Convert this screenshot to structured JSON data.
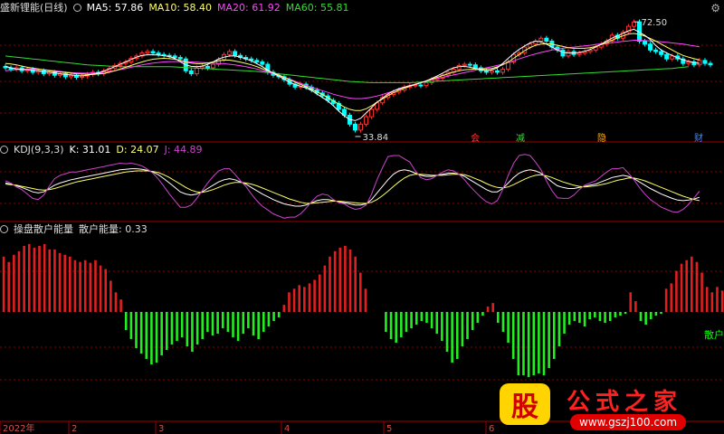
{
  "header": {
    "main": {
      "title": "盛新锂能(日线)",
      "ma": [
        {
          "label": "MA5: 57.86",
          "color": "#ffffff"
        },
        {
          "label": "MA10: 58.40",
          "color": "#ffff66"
        },
        {
          "label": "MA20: 61.92",
          "color": "#ff44ff"
        },
        {
          "label": "MA60: 55.81",
          "color": "#33dd33"
        }
      ]
    },
    "kdj": {
      "title": "KDJ(9,3,3)",
      "k": "K: 31.01",
      "d": "D: 24.07",
      "j": "J: 44.89"
    },
    "energy": {
      "title": "操盘散户能量",
      "value": "散户能量: 0.33"
    }
  },
  "side_label": "散户",
  "price_annotations": {
    "high": "72.50",
    "low": "33.84"
  },
  "signals": [
    {
      "label": "会",
      "color": "#ff3030"
    },
    {
      "label": "减",
      "color": "#33dd33"
    },
    {
      "label": "隐",
      "color": "#ffaa00"
    },
    {
      "label": "财",
      "color": "#4488ff"
    }
  ],
  "x_axis": [
    "2022年",
    "2",
    "3",
    "4",
    "5",
    "6"
  ],
  "brand": {
    "logo": "股",
    "title": "公式之家",
    "url": "www.gszj100.com"
  },
  "colors": {
    "up": "#ff3030",
    "down": "#00ffff",
    "grid": "#8b0000",
    "pos_bar": "#e02020",
    "neg_bar": "#22ee22"
  },
  "chart_data": [
    {
      "type": "candlestick",
      "title": "盛新锂能(日线)",
      "ylim": [
        32,
        75
      ],
      "annotations": [
        {
          "label": "72.50",
          "value": 72.5
        },
        {
          "label": "33.84",
          "value": 33.84
        }
      ],
      "close": [
        57,
        56.5,
        57,
        56,
        56.5,
        55.5,
        56,
        55,
        55.5,
        54.5,
        55,
        54,
        54.5,
        53.8,
        54.2,
        54.8,
        55.5,
        55,
        56,
        56.8,
        57.8,
        58.5,
        59,
        60.2,
        61,
        62,
        62.5,
        62,
        61.5,
        61.2,
        61,
        60.5,
        60,
        56,
        55,
        57,
        57.5,
        57,
        58.2,
        59.8,
        61.5,
        62.5,
        61.2,
        60.5,
        60,
        59.5,
        59,
        58.2,
        55.5,
        54.5,
        54,
        53,
        51.5,
        50.5,
        51.5,
        50.5,
        49.5,
        48.5,
        47.5,
        46,
        45,
        43,
        41,
        38,
        36,
        38,
        40.5,
        43,
        45.2,
        47,
        48,
        48.8,
        49.5,
        50.5,
        51,
        51.2,
        51,
        52,
        53,
        53.5,
        54.5,
        55.5,
        56.5,
        57.8,
        58.2,
        58,
        57,
        56,
        55.5,
        56,
        55.5,
        56.5,
        59,
        61.5,
        62,
        64,
        65,
        66,
        67,
        66,
        64,
        63,
        61,
        62.5,
        61.5,
        62,
        62.5,
        63,
        64,
        65,
        66,
        68,
        67,
        69,
        71,
        72.5,
        66,
        65,
        63,
        62.5,
        61.5,
        60,
        61,
        60,
        58.5,
        59,
        58,
        59.5,
        58.5,
        58
      ],
      "ma5": [
        57.5,
        57,
        56.6,
        56.5,
        56.4,
        56.2,
        56,
        55.7,
        55.5,
        55.3,
        55,
        54.8,
        54.6,
        54.4,
        54.3,
        54.5,
        54.9,
        55.3,
        55.9,
        56.6,
        57.4,
        58.2,
        59,
        59.8,
        60.6,
        61.2,
        61.4,
        61.4,
        61.3,
        61.1,
        60.8,
        60.2,
        59,
        58,
        57.5,
        57.4,
        57.6,
        58.2,
        59,
        60,
        60.6,
        61,
        61,
        60.6,
        60,
        59.4,
        58.4,
        57.4,
        56.2,
        55.2,
        54.2,
        53.2,
        52.2,
        51.4,
        50.8,
        50.2,
        49.4,
        48.2,
        47,
        45.8,
        44.2,
        42.4,
        40.8,
        39.6,
        39.2,
        40,
        41.8,
        43.6,
        45.4,
        46.8,
        48.2,
        49.2,
        50,
        50.5,
        51,
        51.4,
        51.9,
        52.6,
        53.4,
        54.3,
        55.2,
        56.2,
        57,
        57.4,
        57.5,
        57.2,
        56.8,
        56.4,
        56.1,
        56.3,
        57,
        58.5,
        60.2,
        61.8,
        63.2,
        64.4,
        65.4,
        66,
        65.8,
        65,
        64,
        63,
        62.2,
        62,
        62,
        62.2,
        62.6,
        63.2,
        64,
        65,
        66,
        67,
        67.8,
        68.6,
        69.5,
        70,
        69,
        68,
        66.5,
        64.5,
        63,
        62,
        61.2,
        60.4,
        59.7,
        59.2,
        58.8,
        58.5
      ],
      "ma10": [
        58.5,
        58.3,
        58,
        57.6,
        57.2,
        56.9,
        56.6,
        56.3,
        56,
        55.8,
        55.6,
        55.4,
        55.2,
        55,
        54.9,
        54.8,
        54.8,
        54.9,
        55.1,
        55.5,
        56,
        56.6,
        57.2,
        57.8,
        58.4,
        59,
        59.5,
        59.9,
        60.1,
        60.2,
        60.1,
        59.9,
        59.5,
        59,
        58.6,
        58.4,
        58.4,
        58.6,
        59,
        59.4,
        59.6,
        59.6,
        59.3,
        58.9,
        58.5,
        58,
        57.4,
        56.7,
        56,
        55.3,
        54.6,
        53.8,
        53,
        52.2,
        51.4,
        50.6,
        49.8,
        48.9,
        48,
        47,
        45.9,
        44.8,
        43.8,
        43,
        42.6,
        42.6,
        43.2,
        44.2,
        45.4,
        46.5,
        47.6,
        48.6,
        49.4,
        50.1,
        50.8,
        51.4,
        52,
        52.6,
        53.2,
        53.8,
        54.4,
        55,
        55.6,
        56,
        56.3,
        56.5,
        56.6,
        56.6,
        56.6,
        56.8,
        57.3,
        58,
        59,
        60.2,
        61.5,
        62.8,
        63.8,
        64.6,
        65,
        65.1,
        65,
        64.6,
        64.2,
        63.8,
        63.6,
        63.6,
        63.6,
        63.8,
        64.2,
        64.8,
        65.5,
        66.3,
        67.1,
        67.8,
        68.4,
        68.6,
        68.3,
        67.7,
        66.9,
        66,
        65,
        64,
        63,
        62,
        61.2,
        60.6,
        60.1,
        59.7
      ],
      "ma20": [
        56,
        56.2,
        56.4,
        56.5,
        56.6,
        56.6,
        56.5,
        56.4,
        56.2,
        56,
        55.8,
        55.6,
        55.4,
        55.3,
        55.2,
        55.2,
        55.2,
        55.3,
        55.5,
        55.7,
        56,
        56.4,
        56.8,
        57.2,
        57.6,
        58,
        58.3,
        58.6,
        58.8,
        59,
        59.1,
        59.1,
        59.1,
        59.1,
        59,
        58.9,
        58.8,
        58.7,
        58.6,
        58.5,
        58.4,
        58.2,
        58,
        57.7,
        57.4,
        57,
        56.6,
        56.1,
        55.6,
        55,
        54.4,
        53.8,
        53.2,
        52.5,
        51.8,
        51.1,
        50.5,
        49.9,
        49.3,
        48.7,
        48.1,
        47.6,
        47.2,
        46.8,
        46.6,
        46.6,
        46.8,
        47.1,
        47.5,
        48,
        48.6,
        49.2,
        49.8,
        50.4,
        51,
        51.5,
        52,
        52.5,
        53,
        53.4,
        53.8,
        54.2,
        54.6,
        55,
        55.4,
        55.8,
        56.2,
        56.6,
        57,
        57.4,
        57.8,
        58.3,
        58.8,
        59.4,
        60,
        60.6,
        61.2,
        61.7,
        62.2,
        62.6,
        63,
        63.3,
        63.6,
        63.8,
        64,
        64.2,
        64.4,
        64.6,
        64.9,
        65.1,
        65.3,
        65.5,
        65.7,
        65.9,
        66.1,
        66.3,
        66.3,
        66.2,
        66.1,
        66,
        65.8,
        65.6,
        65.4,
        65.2,
        65,
        64.7,
        64.4,
        64.1
      ],
      "ma60": [
        61,
        60.8,
        60.6,
        60.4,
        60.2,
        60,
        59.8,
        59.6,
        59.4,
        59.2,
        59,
        58.8,
        58.6,
        58.4,
        58.2,
        58,
        57.9,
        57.8,
        57.7,
        57.6,
        57.5,
        57.4,
        57.4,
        57.4,
        57.4,
        57.4,
        57.4,
        57.4,
        57.4,
        57.4,
        57.4,
        57.3,
        57.2,
        57.1,
        57,
        56.9,
        56.8,
        56.7,
        56.6,
        56.5,
        56.4,
        56.3,
        56.2,
        56.1,
        56,
        55.9,
        55.8,
        55.6,
        55.4,
        55.2,
        55,
        54.8,
        54.6,
        54.4,
        54.2,
        54,
        53.8,
        53.6,
        53.4,
        53.2,
        53,
        52.8,
        52.6,
        52.4,
        52.3,
        52.2,
        52.1,
        52,
        52,
        52,
        52,
        52,
        52,
        52,
        52,
        52.1,
        52.2,
        52.3,
        52.4,
        52.5,
        52.6,
        52.7,
        52.8,
        52.9,
        53,
        53.1,
        53.2,
        53.3,
        53.4,
        53.5,
        53.6,
        53.7,
        53.8,
        53.9,
        54,
        54.1,
        54.2,
        54.3,
        54.4,
        54.5,
        54.6,
        54.7,
        54.8,
        54.9,
        55,
        55.1,
        55.2,
        55.3,
        55.4,
        55.5,
        55.6,
        55.7,
        55.8,
        55.9,
        56,
        56.1,
        56.2,
        56.3,
        56.4,
        56.5,
        56.6,
        56.7,
        56.8,
        57,
        57.2,
        57.4
      ]
    },
    {
      "type": "line",
      "title": "KDJ(9,3,3)",
      "ylim": [
        -10,
        110
      ],
      "series": [
        {
          "name": "K",
          "color": "#ffffff",
          "values": [
            60,
            58,
            55,
            52,
            48,
            44,
            42,
            44,
            50,
            56,
            60,
            63,
            66,
            68,
            70,
            72,
            74,
            76,
            78,
            80,
            82,
            84,
            85,
            86,
            86,
            85,
            83,
            80,
            75,
            68,
            60,
            52,
            44,
            40,
            38,
            40,
            44,
            50,
            56,
            62,
            66,
            68,
            66,
            62,
            58,
            52,
            46,
            40,
            35,
            30,
            26,
            22,
            20,
            18,
            18,
            20,
            24,
            28,
            30,
            30,
            28,
            26,
            24,
            22,
            20,
            20,
            22,
            30,
            42,
            54,
            66,
            76,
            82,
            84,
            82,
            78,
            74,
            72,
            72,
            74,
            76,
            78,
            78,
            76,
            72,
            66,
            60,
            54,
            48,
            44,
            44,
            50,
            60,
            70,
            78,
            82,
            84,
            82,
            78,
            70,
            62,
            55,
            52,
            50,
            50,
            52,
            54,
            56,
            58,
            62,
            66,
            70,
            72,
            74,
            72,
            68,
            62,
            56,
            50,
            45,
            40,
            36,
            32,
            29,
            28,
            29,
            31,
            34
          ]
        },
        {
          "name": "D",
          "color": "#ffff66",
          "values": [
            58,
            57,
            56,
            54,
            52,
            50,
            48,
            47,
            48,
            50,
            53,
            56,
            59,
            62,
            64,
            66,
            68,
            70,
            72,
            74,
            76,
            78,
            80,
            81,
            82,
            82,
            82,
            81,
            79,
            75,
            70,
            64,
            58,
            52,
            47,
            44,
            43,
            45,
            48,
            52,
            56,
            59,
            61,
            61,
            60,
            58,
            55,
            51,
            47,
            43,
            39,
            35,
            31,
            28,
            25,
            23,
            23,
            24,
            25,
            26,
            27,
            27,
            26,
            25,
            24,
            23,
            23,
            25,
            30,
            37,
            45,
            54,
            62,
            69,
            74,
            76,
            76,
            75,
            74,
            74,
            74,
            75,
            76,
            76,
            75,
            72,
            68,
            64,
            59,
            55,
            52,
            51,
            53,
            57,
            62,
            67,
            71,
            74,
            75,
            73,
            70,
            66,
            62,
            59,
            56,
            54,
            53,
            54,
            55,
            57,
            59,
            62,
            65,
            67,
            69,
            69,
            67,
            64,
            60,
            56,
            52,
            48,
            44,
            40,
            36,
            33,
            30,
            28
          ]
        },
        {
          "name": "J",
          "color": "#cc44cc",
          "values": [
            64,
            60,
            53,
            48,
            40,
            32,
            30,
            38,
            54,
            68,
            74,
            77,
            80,
            80,
            82,
            84,
            86,
            88,
            90,
            92,
            94,
            96,
            95,
            96,
            94,
            91,
            85,
            78,
            67,
            54,
            40,
            28,
            16,
            16,
            20,
            32,
            46,
            60,
            72,
            82,
            86,
            86,
            76,
            64,
            54,
            40,
            28,
            18,
            11,
            4,
            0,
            -4,
            -2,
            -2,
            4,
            14,
            26,
            36,
            40,
            38,
            30,
            24,
            22,
            16,
            12,
            14,
            20,
            40,
            66,
            88,
            108,
            110,
            110,
            104,
            98,
            82,
            70,
            66,
            68,
            74,
            80,
            84,
            82,
            76,
            66,
            54,
            44,
            34,
            26,
            22,
            28,
            48,
            74,
            96,
            110,
            112,
            110,
            98,
            84,
            64,
            46,
            33,
            32,
            32,
            38,
            48,
            56,
            60,
            64,
            72,
            80,
            86,
            86,
            88,
            78,
            66,
            52,
            40,
            30,
            23,
            16,
            12,
            8,
            7,
            12,
            21,
            33,
            45
          ]
        }
      ]
    },
    {
      "type": "bar",
      "title": "操盘散户能量",
      "ylim": [
        -75,
        80
      ],
      "values": [
        62,
        56,
        64,
        68,
        74,
        76,
        72,
        74,
        76,
        70,
        70,
        66,
        64,
        62,
        58,
        56,
        58,
        55,
        58,
        52,
        48,
        35,
        22,
        14,
        -20,
        -30,
        -40,
        -46,
        -52,
        -58,
        -56,
        -48,
        -42,
        -36,
        -32,
        -28,
        -38,
        -44,
        -36,
        -30,
        -22,
        -26,
        -24,
        -18,
        -22,
        -28,
        -32,
        -24,
        -18,
        -26,
        -30,
        -22,
        -16,
        -10,
        -6,
        8,
        22,
        26,
        30,
        28,
        32,
        36,
        42,
        52,
        62,
        68,
        72,
        74,
        70,
        62,
        44,
        26,
        0,
        0,
        0,
        -22,
        -30,
        -34,
        -28,
        -22,
        -18,
        -14,
        -10,
        -12,
        -18,
        -24,
        -32,
        -44,
        -56,
        -52,
        -38,
        -30,
        -20,
        -12,
        -4,
        6,
        10,
        -12,
        -22,
        -34,
        -52,
        -70,
        -70,
        -72,
        -70,
        -68,
        -70,
        -62,
        -52,
        -38,
        -24,
        -14,
        -10,
        -12,
        -16,
        -8,
        -6,
        -10,
        -12,
        -10,
        -6,
        -4,
        -2,
        22,
        12,
        -10,
        -14,
        -8,
        -4,
        -2,
        26,
        32,
        46,
        54,
        58,
        62,
        56,
        44,
        28,
        22,
        28,
        24
      ]
    }
  ]
}
